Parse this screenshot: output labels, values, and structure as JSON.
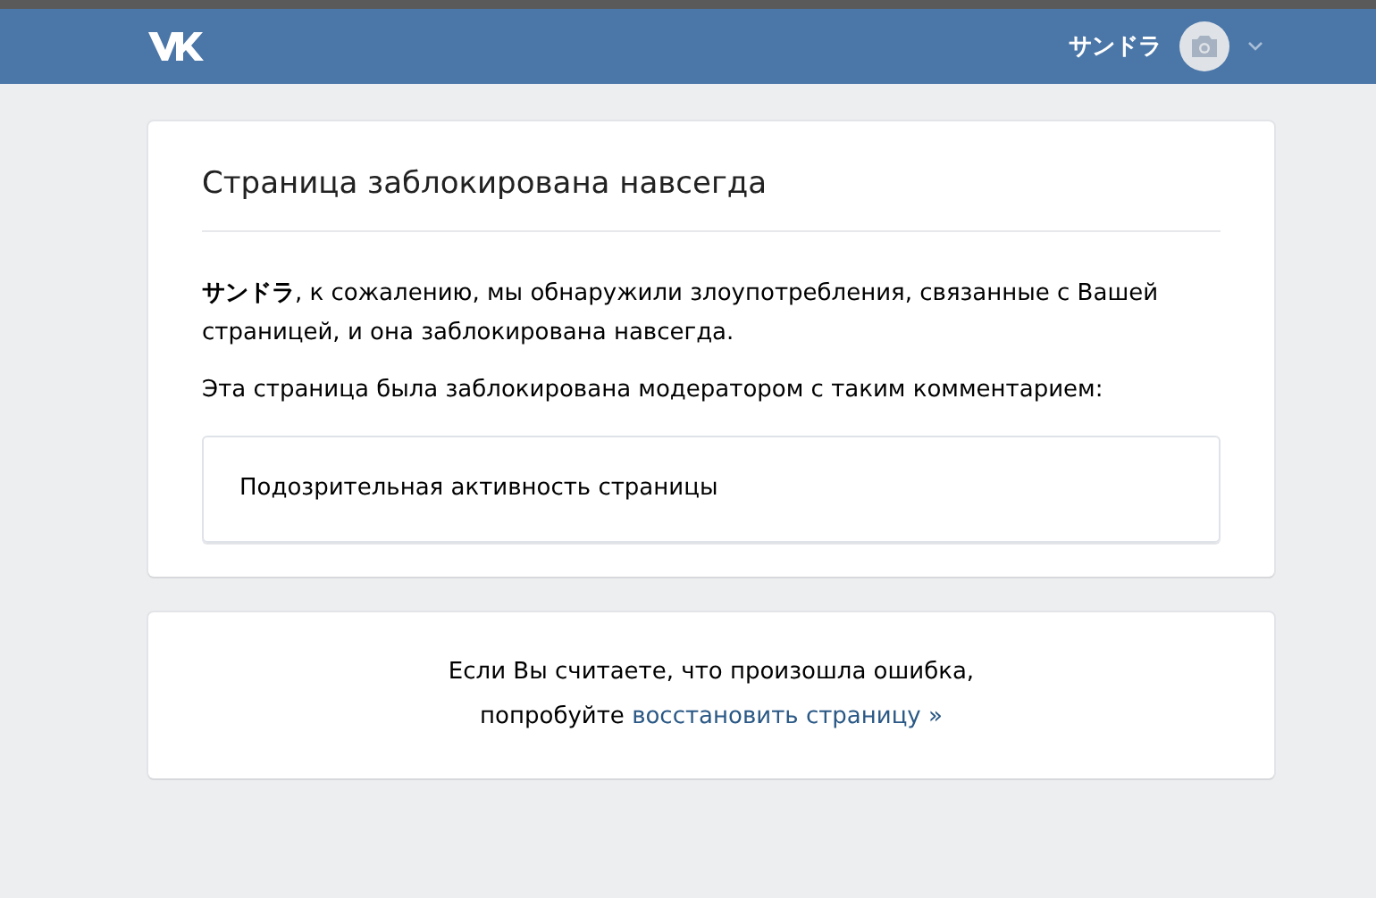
{
  "header": {
    "user_name": "サンドラ"
  },
  "blocked_card": {
    "title": "Страница заблокирована навсегда",
    "message": "**サンドラ**, к сожалению, мы обнаружили злоупотребления, связанные с Вашей страницей, и она заблокирована навсегда.",
    "comment_intro": "Эта страница была заблокирована модератором с таким комментарием:",
    "comment": "Подозрительная активность страницы"
  },
  "restore_card": {
    "line_1": "Если Вы считаете, что произошла ошибка,",
    "line_2_prefix": "попробуйте",
    "link": "восстановить страницу »"
  }
}
